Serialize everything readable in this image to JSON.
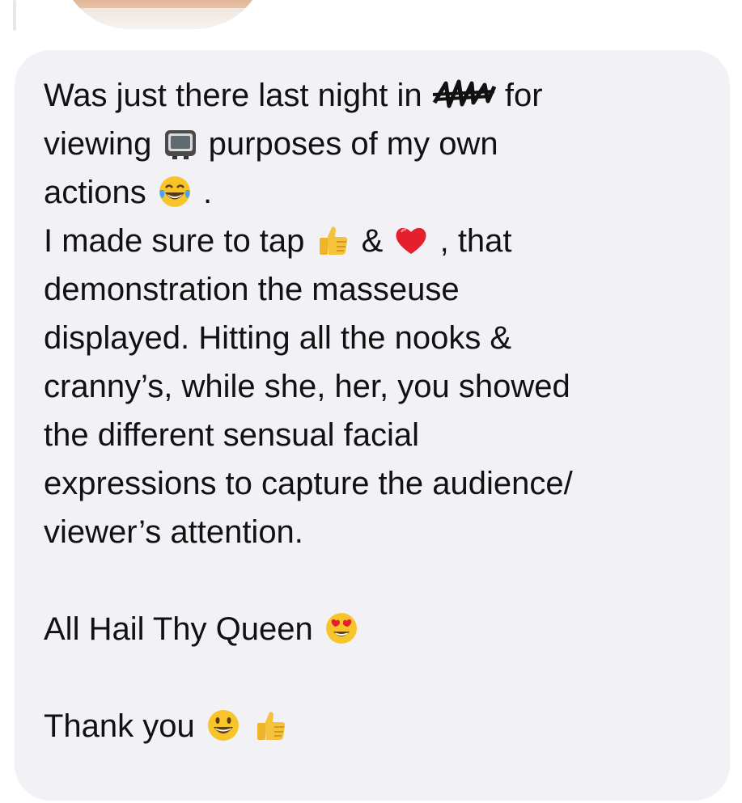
{
  "message": {
    "line1_a": "Was just there last night in",
    "line1_b": "for",
    "line2_a": "viewing",
    "line2_b": "purposes of my own",
    "line3_a": "actions",
    "line3_b": ".",
    "line4_a": "I made sure to tap",
    "line4_b": "&",
    "line4_c": ", that",
    "line5": "demonstration the masseuse",
    "line6": "displayed. Hitting all the nooks &",
    "line7": "cranny’s, while she, her, you showed",
    "line8": "the different sensual facial",
    "line9": "expressions to capture the audience/",
    "line10": "viewer’s attention.",
    "line11": "All Hail Thy Queen",
    "line12": "Thank you"
  },
  "emojis": [
    "television",
    "face-with-tears-of-joy",
    "thumbs-up",
    "red-heart",
    "smiling-face-with-heart-eyes",
    "grinning-face",
    "thumbs-up"
  ],
  "colors": {
    "bubble": "#f2f2f6",
    "text": "#111111"
  }
}
